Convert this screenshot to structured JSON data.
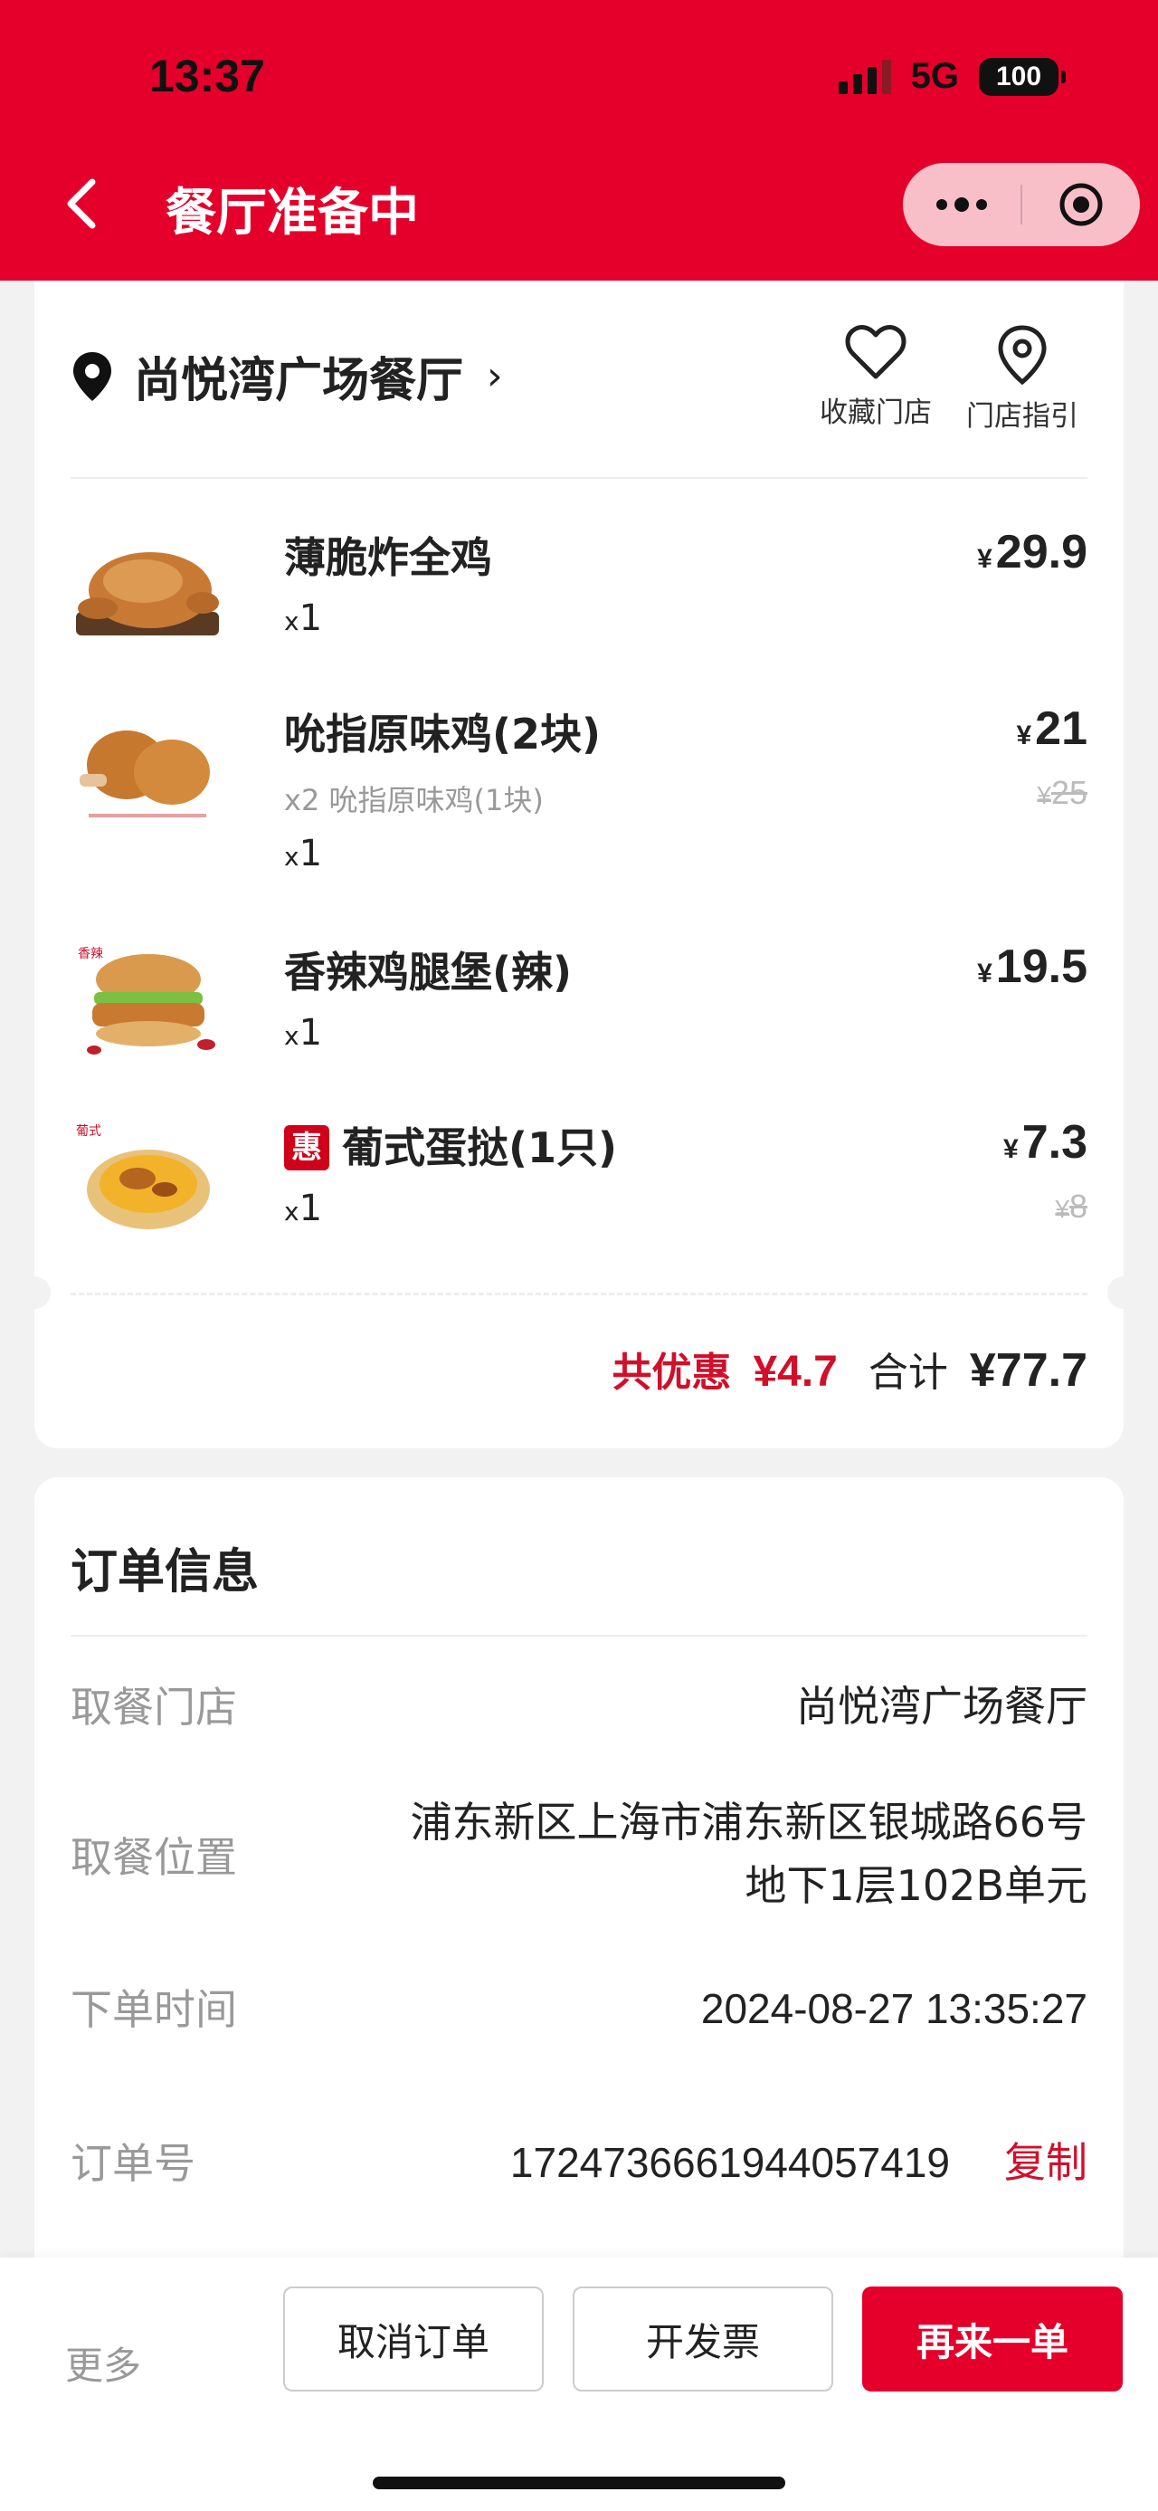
{
  "status_bar": {
    "time": "13:37",
    "network": "5G",
    "battery": "100"
  },
  "header": {
    "title": "餐厅准备中"
  },
  "store": {
    "name": "尚悦湾广场餐厅",
    "favorite_label": "收藏门店",
    "directions_label": "门店指引"
  },
  "items": [
    {
      "name": "薄脆炸全鸡",
      "sub": "",
      "qty": "1",
      "price": "29.9",
      "orig": ""
    },
    {
      "name": "吮指原味鸡(2块)",
      "sub": "x2 吮指原味鸡(1块)",
      "qty": "1",
      "price": "21",
      "orig": "25"
    },
    {
      "name": "香辣鸡腿堡(辣)",
      "sub": "",
      "qty": "1",
      "price": "19.5",
      "orig": ""
    },
    {
      "name": "葡式蛋挞(1只)",
      "sub": "",
      "qty": "1",
      "price": "7.3",
      "orig": "8",
      "badge": "惠"
    }
  ],
  "summary": {
    "discount_label": "共优惠",
    "discount_amount": "¥4.7",
    "total_label": "合计",
    "total_amount": "¥77.7"
  },
  "order_info": {
    "title": "订单信息",
    "rows": [
      {
        "key": "取餐门店",
        "value": "尚悦湾广场餐厅"
      },
      {
        "key": "取餐位置",
        "value_line1": "浦东新区上海市浦东新区银城路66号",
        "value_line2": "地下1层102B单元"
      },
      {
        "key": "下单时间",
        "value": "2024-08-27 13:35:27"
      },
      {
        "key": "订单号",
        "value": "1724736661944057419",
        "action": "复制"
      }
    ]
  },
  "bottom_bar": {
    "more": "更多",
    "cancel": "取消订单",
    "invoice": "开发票",
    "reorder": "再来一单"
  },
  "currency": "¥",
  "qty_prefix": "x",
  "colors": {
    "brand_red": "#e4002b",
    "discount_red": "#d0102b"
  }
}
